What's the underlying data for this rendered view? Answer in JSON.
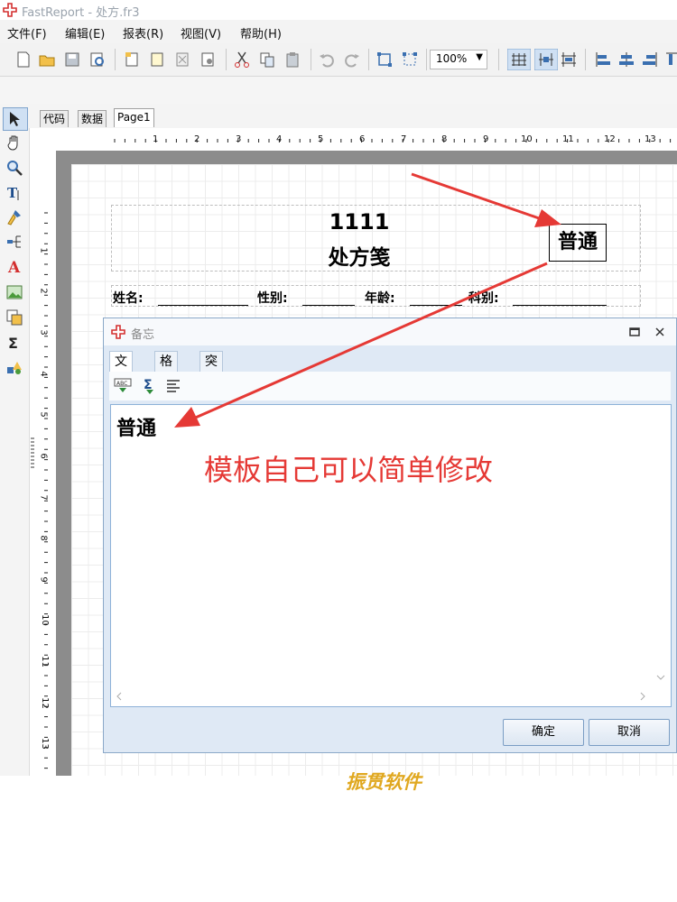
{
  "window": {
    "title": "FastReport - 处方.fr3"
  },
  "menu": [
    "文件(F)",
    "编辑(E)",
    "报表(R)",
    "视图(V)",
    "帮助(H)"
  ],
  "toolbar": {
    "zoom": "100%"
  },
  "tabs": [
    "代码",
    "数据",
    "Page1"
  ],
  "ruler": {
    "h": [
      "1",
      "2",
      "3",
      "4",
      "5",
      "6",
      "7",
      "8",
      "9",
      "10",
      "11",
      "12",
      "13"
    ],
    "v": [
      "1",
      "2",
      "3",
      "4",
      "5",
      "6",
      "7",
      "8",
      "9",
      "10",
      "11",
      "12",
      "13"
    ]
  },
  "report": {
    "title_number": "1111",
    "title": "处方笺",
    "tag": "普通",
    "fields": [
      "姓名:",
      "性别:",
      "年龄:",
      "科别:"
    ]
  },
  "dialog": {
    "title": "备忘",
    "tabs": [
      "文本",
      "格式",
      "突显"
    ],
    "memo_text": "普通",
    "ok": "确定",
    "cancel": "取消"
  },
  "annotation": "模板自己可以简单修改",
  "watermark": "振贯软件",
  "colors": {
    "arrow": "#e53935",
    "watermark": "#e0a820",
    "dialog_bg": "#dfe9f5"
  }
}
